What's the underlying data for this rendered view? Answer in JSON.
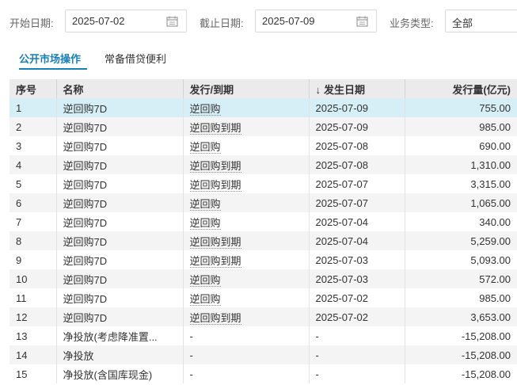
{
  "filters": {
    "start_label": "开始日期:",
    "start_value": "2025-07-02",
    "end_label": "截止日期:",
    "end_value": "2025-07-09",
    "type_label": "业务类型:",
    "type_value": "全部"
  },
  "tabs": [
    {
      "label": "公开市场操作",
      "active": true
    },
    {
      "label": "常备借贷便利",
      "active": false
    }
  ],
  "table": {
    "headers": {
      "seq": "序号",
      "name": "名称",
      "issue": "发行/到期",
      "date": "发生日期",
      "date_sort": "↓",
      "amount": "发行量(亿元)"
    },
    "rows": [
      {
        "seq": "1",
        "name": "逆回购7D",
        "issue": "逆回购",
        "date": "2025-07-09",
        "amount": "755.00"
      },
      {
        "seq": "2",
        "name": "逆回购7D",
        "issue": "逆回购到期",
        "date": "2025-07-09",
        "amount": "985.00"
      },
      {
        "seq": "3",
        "name": "逆回购7D",
        "issue": "逆回购",
        "date": "2025-07-08",
        "amount": "690.00"
      },
      {
        "seq": "4",
        "name": "逆回购7D",
        "issue": "逆回购到期",
        "date": "2025-07-08",
        "amount": "1,310.00"
      },
      {
        "seq": "5",
        "name": "逆回购7D",
        "issue": "逆回购到期",
        "date": "2025-07-07",
        "amount": "3,315.00"
      },
      {
        "seq": "6",
        "name": "逆回购7D",
        "issue": "逆回购",
        "date": "2025-07-07",
        "amount": "1,065.00"
      },
      {
        "seq": "7",
        "name": "逆回购7D",
        "issue": "逆回购",
        "date": "2025-07-04",
        "amount": "340.00"
      },
      {
        "seq": "8",
        "name": "逆回购7D",
        "issue": "逆回购到期",
        "date": "2025-07-04",
        "amount": "5,259.00"
      },
      {
        "seq": "9",
        "name": "逆回购7D",
        "issue": "逆回购到期",
        "date": "2025-07-03",
        "amount": "5,093.00"
      },
      {
        "seq": "10",
        "name": "逆回购7D",
        "issue": "逆回购",
        "date": "2025-07-03",
        "amount": "572.00"
      },
      {
        "seq": "11",
        "name": "逆回购7D",
        "issue": "逆回购",
        "date": "2025-07-02",
        "amount": "985.00"
      },
      {
        "seq": "12",
        "name": "逆回购7D",
        "issue": "逆回购到期",
        "date": "2025-07-02",
        "amount": "3,653.00"
      },
      {
        "seq": "13",
        "name": "净投放(考虑降准置...",
        "issue": "-",
        "date": "-",
        "amount": "-15,208.00"
      },
      {
        "seq": "14",
        "name": "净投放",
        "issue": "-",
        "date": "-",
        "amount": "-15,208.00"
      },
      {
        "seq": "15",
        "name": "净投放(含国库现金)",
        "issue": "-",
        "date": "-",
        "amount": "-15,208.00"
      }
    ],
    "selected_row": "1"
  },
  "colors": {
    "accent": "#1a7fb5",
    "header_bg": "#ebebeb",
    "selected_row": "#d6eef5",
    "zebra": "#f4f4f4"
  }
}
